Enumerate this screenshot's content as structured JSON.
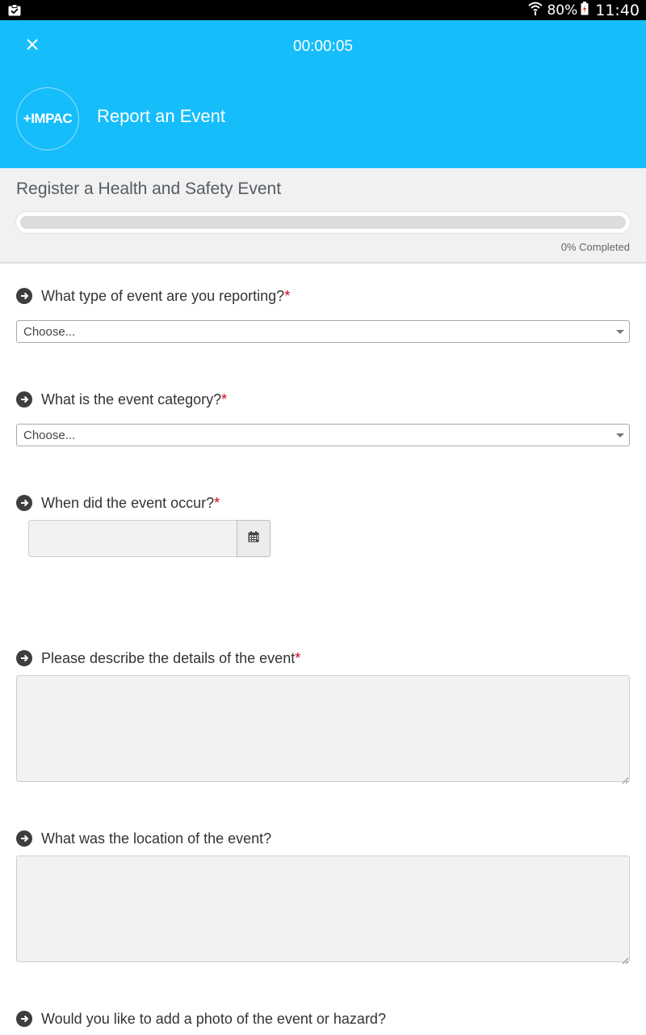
{
  "status_bar": {
    "battery": "80%",
    "time": "11:40"
  },
  "header": {
    "timer": "00:00:05",
    "logo_text": "+IMPAC",
    "title": "Report an Event",
    "accent_color": "#16bdfb"
  },
  "form": {
    "title": "Register a Health and Safety Event",
    "progress_percent": 0,
    "progress_text": "0% Completed"
  },
  "questions": [
    {
      "label": "What type of event are you reporting?",
      "required": "*",
      "type": "select",
      "value": "Choose..."
    },
    {
      "label": "What is the event category?",
      "required": "*",
      "type": "select",
      "value": "Choose..."
    },
    {
      "label": "When did the event occur?",
      "required": "*",
      "type": "date",
      "value": ""
    },
    {
      "label": "Please describe the details of the event",
      "required": "*",
      "type": "textarea",
      "value": ""
    },
    {
      "label": "What was the location of the event?",
      "required": "",
      "type": "textarea",
      "value": ""
    },
    {
      "label": "Would you like to add a photo of the event or hazard?",
      "required": "",
      "type": "photo"
    }
  ]
}
